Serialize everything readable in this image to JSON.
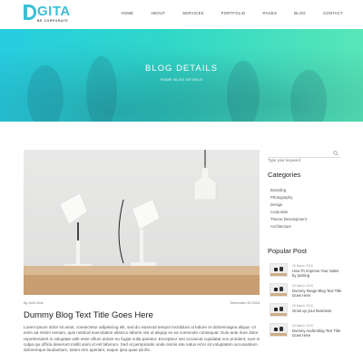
{
  "brand": {
    "name": "GITA",
    "tagline": "BE CORPORATE"
  },
  "nav": [
    "HOME",
    "ABOUT",
    "SERVICES",
    "PORTFOLIO",
    "PAGES",
    "BLOG",
    "CONTACT"
  ],
  "hero": {
    "title": "BLOG DETAILS",
    "breadcrumb": "HOME  BLOG DETAILS"
  },
  "post": {
    "author": "By John Doe",
    "date": "December 26 2018",
    "title": "Dummy Blog Text Title Goes Here",
    "body": "Lorem ipsum dolor sit amet, consectetur adipisicing elit, sed do eiusmod tempor incididunt ut labore et doloremagna aliqua. Ut enim ad minim veniam, quis nostrud exercitation ullamco laboris nisi ut aliquip ex ea commodo consequat. Duis aute irure dolor reprehenderit in voluptate velit esse cillum dolore eu fugiat nulla pariatur. Excepteur sint occaecat cupidatat non proident, sunt in culpa qui officia deserunt mollit anim id est laborum. Sed ut perspiciatis unde omnis iste natus error sit voluptatem accusantium doloremque laudantium, totam rem aperiam, eaque ipsa quae ab illo."
  },
  "sidebar": {
    "search_placeholder": "Type your keyword",
    "categories_heading": "Categories",
    "categories": [
      "Branding",
      "Photography",
      "Design",
      "Corporate",
      "Theme Development",
      "Architecture"
    ],
    "popular_heading": "Popular Post",
    "popular": [
      {
        "date": "26 March 2018",
        "title": "How To Improve Your Sales by posting"
      },
      {
        "date": "26 March 2018",
        "title": "Dummy Image Blog Text Title Goes Here"
      },
      {
        "date": "26 March 2018",
        "title": "Grow up your Business"
      },
      {
        "date": "26 March 2018",
        "title": "Dummy Audio Blog Text Title Goes Here"
      }
    ]
  },
  "colors": {
    "accent": "#39c0d6",
    "hero_start": "#27cde0",
    "hero_end": "#57e6b7"
  }
}
